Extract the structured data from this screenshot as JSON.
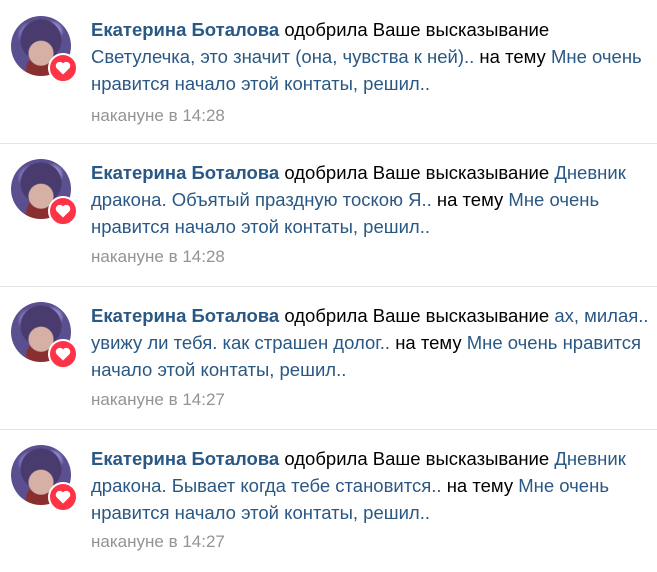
{
  "colors": {
    "link": "#2a5885",
    "text": "#000000",
    "muted": "#939393",
    "like_badge": "#ff3347",
    "divider": "#e1e5ea"
  },
  "icons": {
    "avatar": "user-avatar",
    "badge": "heart-icon"
  },
  "notifications": [
    {
      "author": "Екатерина Боталова",
      "action": "одобрила Ваше высказывание",
      "quote": "Светулечка, это значит (она, чувства к ней)..",
      "topic_prefix": "на тему",
      "topic": "Мне очень нравится начало этой контаты, решил..",
      "time": "накануне в 14:28"
    },
    {
      "author": "Екатерина Боталова",
      "action": "одобрила Ваше высказывание",
      "quote": "Дневник дракона. Объятый праздную тоскою Я..",
      "topic_prefix": "на тему",
      "topic": "Мне очень нравится начало этой контаты, решил..",
      "time": "накануне в 14:28"
    },
    {
      "author": "Екатерина Боталова",
      "action": "одобрила Ваше высказывание",
      "quote": "ах, милая.. увижу ли тебя. как страшен долог..",
      "topic_prefix": "на тему",
      "topic": "Мне очень нравится начало этой контаты, решил..",
      "time": "накануне в 14:27"
    },
    {
      "author": "Екатерина Боталова",
      "action": "одобрила Ваше высказывание",
      "quote": "Дневник дракона. Бывает когда тебе становится..",
      "topic_prefix": "на тему",
      "topic": "Мне очень нравится начало этой контаты, решил..",
      "time": "накануне в 14:27"
    }
  ]
}
